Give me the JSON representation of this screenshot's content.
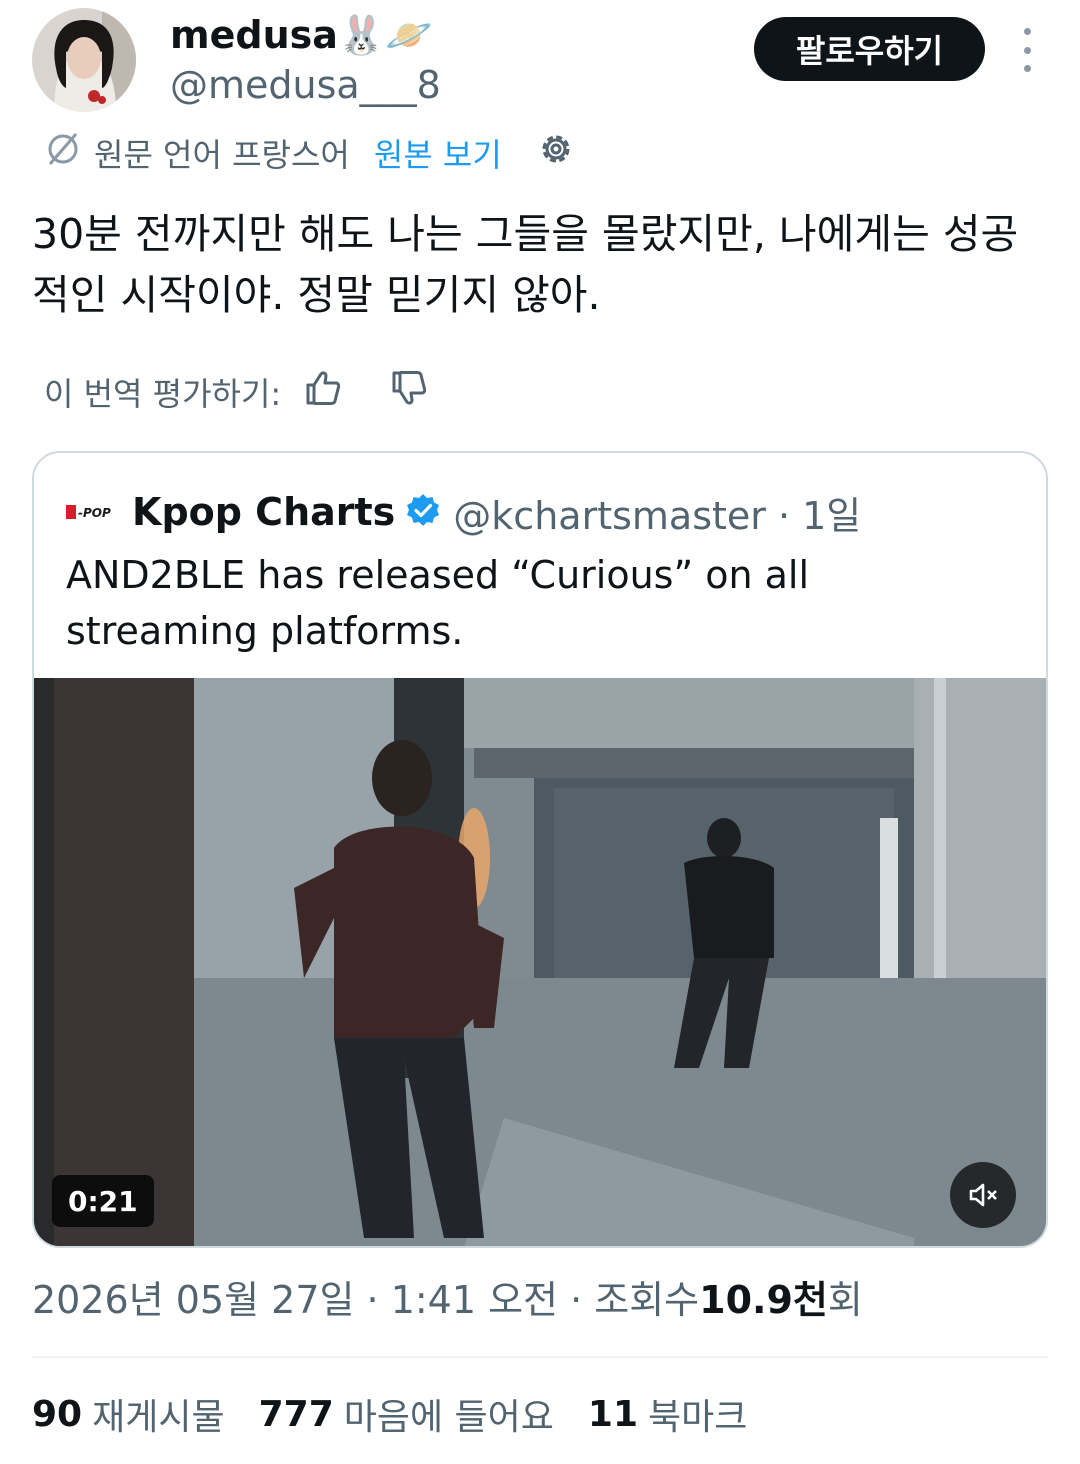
{
  "author": {
    "display_name": "medusa🐰🪐",
    "handle": "@medusa___8"
  },
  "follow_label": "팔로우하기",
  "translation": {
    "source_language": "원문 언어 프랑스어",
    "view_original": "원본 보기"
  },
  "tweet": {
    "text": "30분 전까지만 해도 나는 그들을 몰랐지만, 나에게는 성공적인 시작이야. 정말 믿기지 않아."
  },
  "rating": {
    "label": "이 번역 평가하기:"
  },
  "quote": {
    "logo_text": "K-POP",
    "name": "Kpop Charts",
    "handle_time": "@kchartsmaster · 1일",
    "text": "AND2BLE has released “Curious” on all streaming platforms.",
    "video_duration": "0:21"
  },
  "meta": {
    "timestamp": "2026년 05월 27일 · 1:41 오전 · 조회수 ",
    "views_number": "10.9천",
    "views_suffix": "회"
  },
  "stats": {
    "reposts_count": "90",
    "reposts_label": "재게시물",
    "likes_count": "777",
    "likes_label": "마음에 들어요",
    "bookmarks_count": "11",
    "bookmarks_label": "북마크"
  },
  "colors": {
    "accent": "#1d9bf0",
    "text": "#0f1419",
    "secondary": "#536471"
  }
}
